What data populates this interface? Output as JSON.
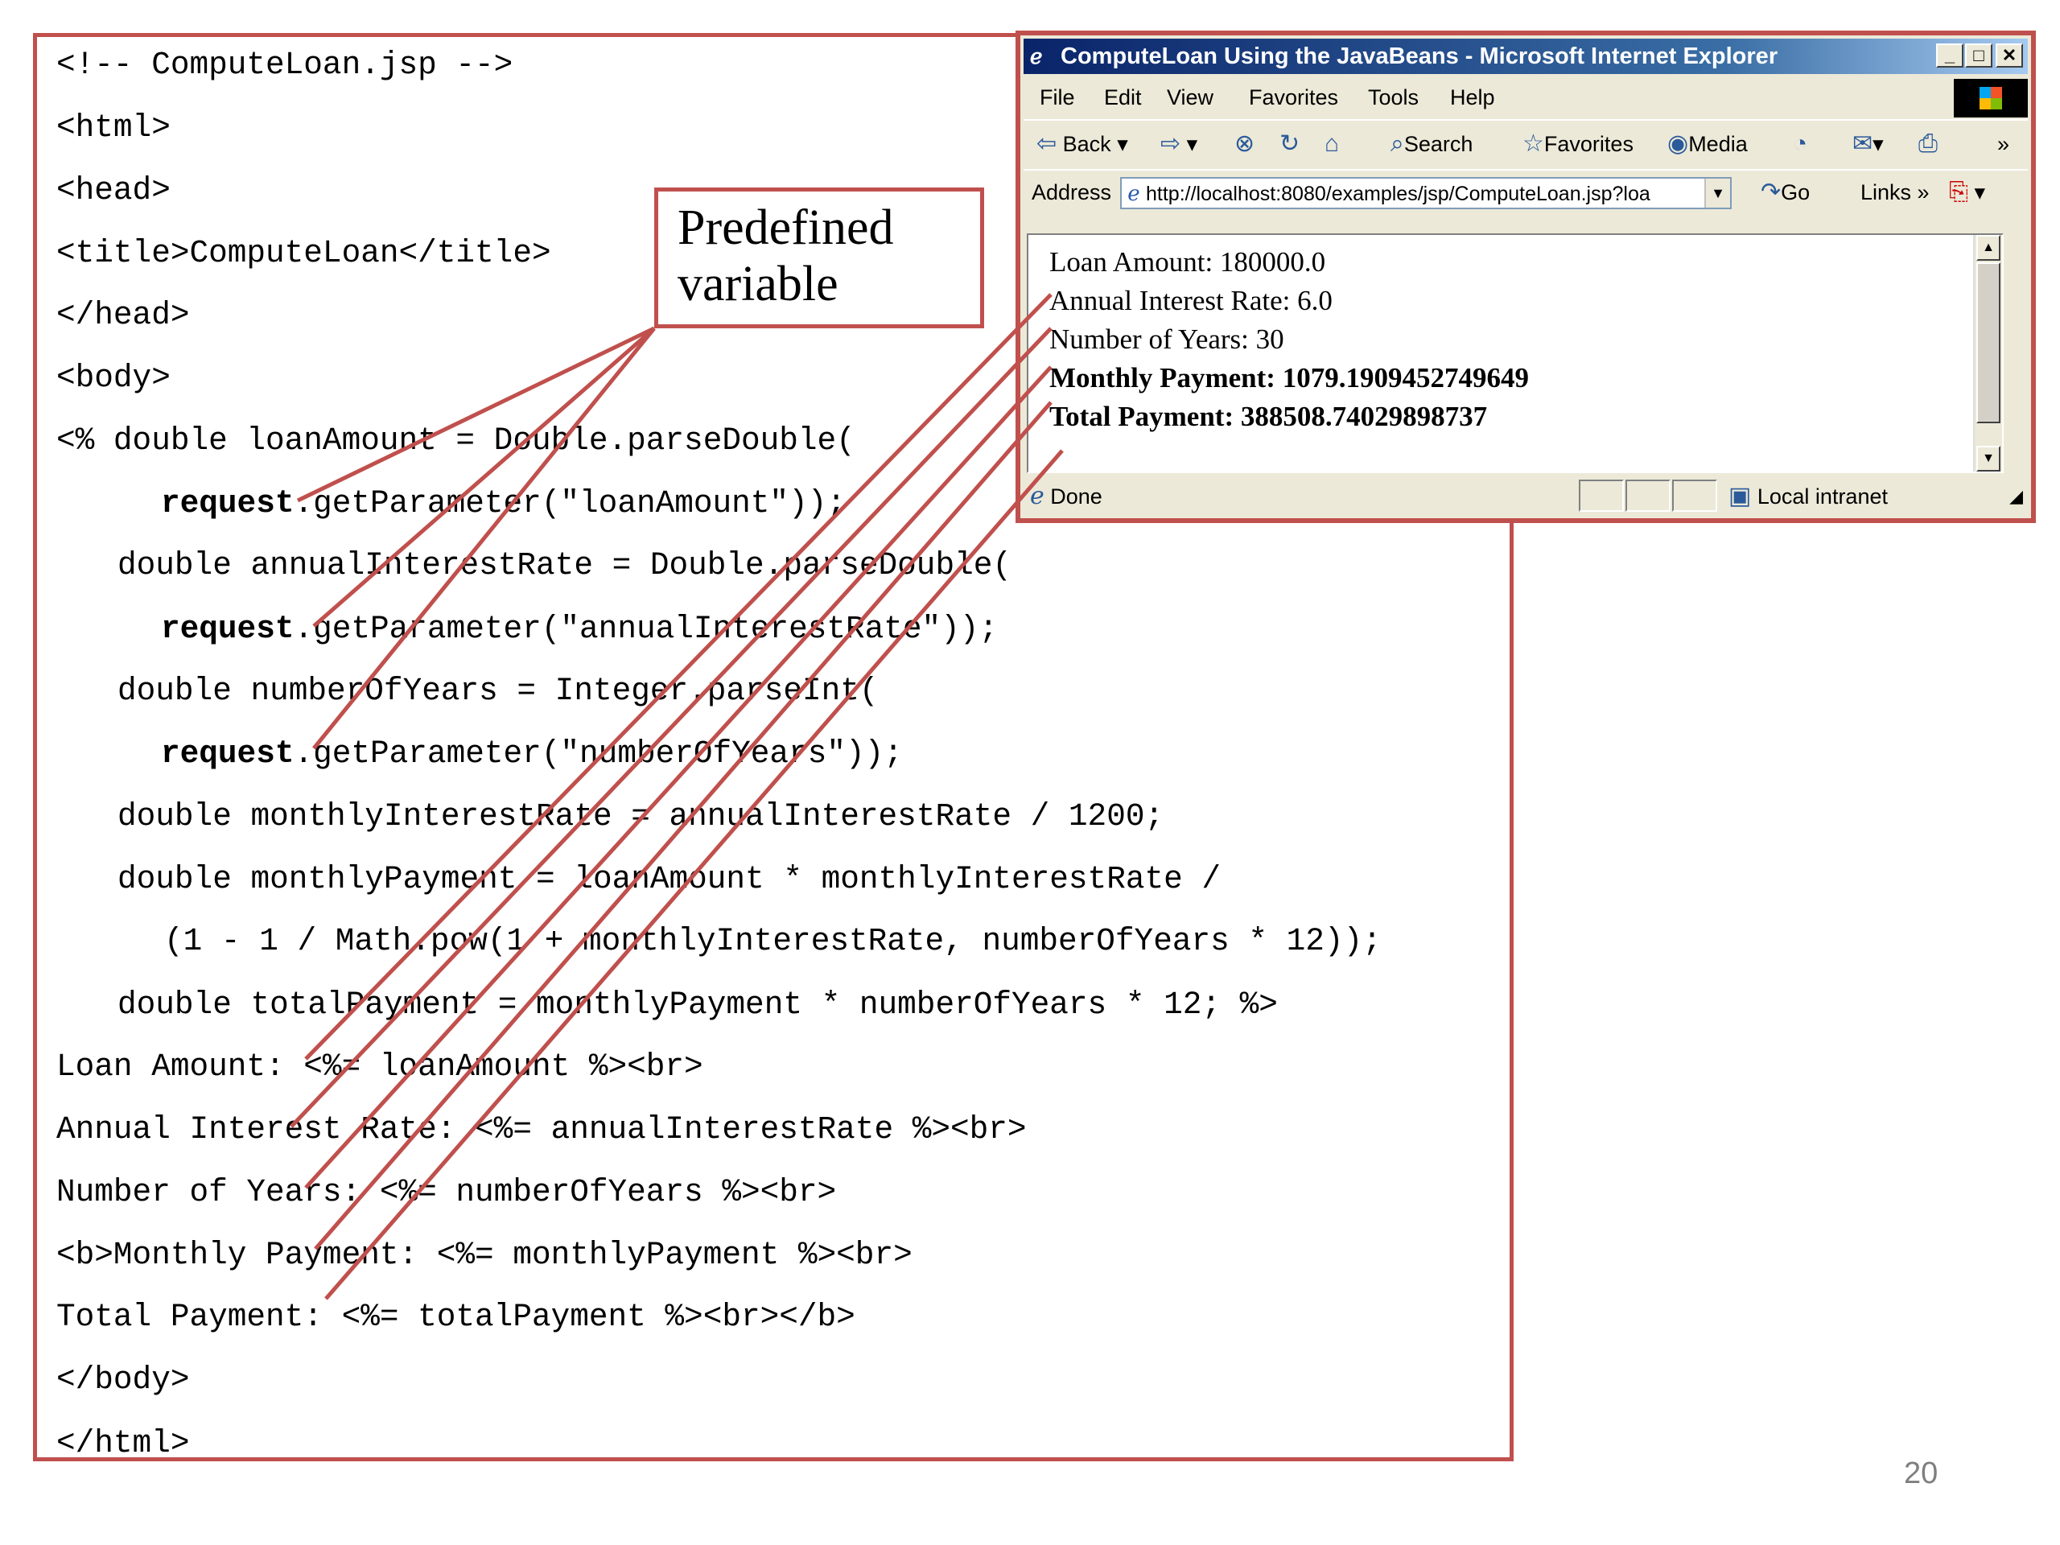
{
  "code": {
    "lines": [
      "<!-- ComputeLoan.jsp -->",
      "<html>",
      "<head>",
      "<title>ComputeLoan</title>",
      "</head>",
      "<body>",
      "<% double loanAmount = Double.parseDouble(",
      [
        "request",
        ".getParameter(\"loanAmount\"));"
      ],
      "double annualInterestRate = Double.parseDouble(",
      [
        "request",
        ".getParameter(\"annualInterestRate\"));"
      ],
      "double numberOfYears = Integer.parseInt(",
      [
        "request",
        ".getParameter(\"numberOfYears\"));"
      ],
      "double monthlyInterestRate = annualInterestRate / 1200;",
      "double monthlyPayment = loanAmount * monthlyInterestRate /",
      "(1 - 1 / Math.pow(1 + monthlyInterestRate, numberOfYears * 12));",
      "double totalPayment = monthlyPayment * numberOfYears * 12; %>",
      "Loan Amount: <%= loanAmount %><br>",
      "Annual Interest Rate: <%= annualInterestRate %><br>",
      "Number of Years: <%= numberOfYears %><br>",
      "<b>Monthly Payment: <%= monthlyPayment %><br>",
      "Total Payment: <%= totalPayment %><br></b>",
      "</body>",
      "</html>"
    ]
  },
  "callout": {
    "line1": "Predefined",
    "line2": "variable"
  },
  "browser": {
    "title": "ComputeLoan Using the JavaBeans - Microsoft Internet Explorer",
    "menu": [
      "File",
      "Edit",
      "View",
      "Favorites",
      "Tools",
      "Help"
    ],
    "toolbar": {
      "back": "Back",
      "search": "Search",
      "favorites": "Favorites",
      "media": "Media"
    },
    "address": {
      "label": "Address",
      "url": "http://localhost:8080/examples/jsp/ComputeLoan.jsp?loa",
      "go": "Go",
      "links": "Links"
    },
    "content": {
      "loan_amount": "Loan Amount: 180000.0",
      "annual_rate": "Annual Interest Rate: 6.0",
      "years": "Number of Years: 30",
      "monthly": "Monthly Payment: 1079.1909452749649",
      "total": "Total Payment: 388508.74029898737"
    },
    "status": {
      "text": "Done",
      "zone": "Local intranet"
    }
  },
  "page_number": "20",
  "colors": {
    "accent": "#c0504d"
  }
}
